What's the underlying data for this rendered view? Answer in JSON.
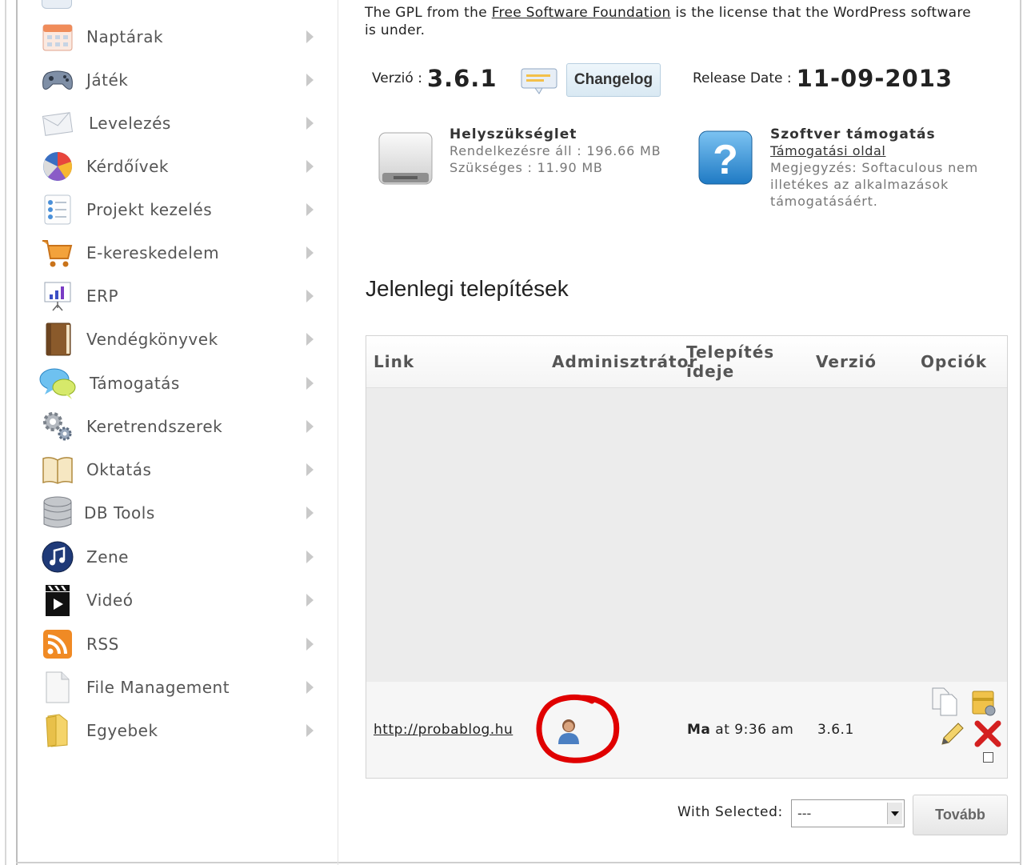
{
  "sidebar": {
    "items": [
      {
        "label": "Naptárak",
        "icon": "calendar-icon"
      },
      {
        "label": "Játék",
        "icon": "gamepad-icon"
      },
      {
        "label": "Levelezés",
        "icon": "envelope-icon"
      },
      {
        "label": "Kérdőívek",
        "icon": "pie-chart-icon"
      },
      {
        "label": "Projekt kezelés",
        "icon": "checklist-icon"
      },
      {
        "label": "E-kereskedelem",
        "icon": "cart-icon"
      },
      {
        "label": "ERP",
        "icon": "presentation-chart-icon"
      },
      {
        "label": "Vendégkönyvek",
        "icon": "book-icon"
      },
      {
        "label": "Támogatás",
        "icon": "chat-bubbles-icon"
      },
      {
        "label": "Keretrendszerek",
        "icon": "gears-icon"
      },
      {
        "label": "Oktatás",
        "icon": "open-book-icon"
      },
      {
        "label": "DB Tools",
        "icon": "database-icon"
      },
      {
        "label": "Zene",
        "icon": "music-note-icon"
      },
      {
        "label": "Videó",
        "icon": "clapperboard-icon"
      },
      {
        "label": "RSS",
        "icon": "rss-icon"
      },
      {
        "label": "File Management",
        "icon": "file-icon"
      },
      {
        "label": "Egyebek",
        "icon": "folder-icon"
      }
    ]
  },
  "license": {
    "prefix": "The GPL from the ",
    "link": "Free Software Foundation",
    "suffix": " is the license that the WordPress software is under."
  },
  "version": {
    "label": "Verzió :",
    "value": "3.6.1",
    "changelog_button": "Changelog",
    "release_label": "Release Date :",
    "release_date": "11-09-2013"
  },
  "space": {
    "title": "Helyszükséglet",
    "available": "Rendelkezésre áll : 196.66 MB",
    "required": "Szükséges : 11.90 MB"
  },
  "support": {
    "title": "Szoftver támogatás",
    "link": "Támogatási oldal",
    "note_line1": "Megjegyzés: Softaculous nem",
    "note_line2": "illetékes az alkalmazások",
    "note_line3": "támogatásáért."
  },
  "installations": {
    "title": "Jelenlegi telepítések",
    "columns": {
      "link": "Link",
      "admin": "Adminisztrátor",
      "install_time_line1": "Telepítés",
      "install_time_line2": "ideje",
      "version": "Verzió",
      "options": "Opciók"
    },
    "rows": [
      {
        "link": "http://probablog.hu",
        "time_bold": "Ma",
        "time_rest": " at 9:36 am",
        "version": "3.6.1"
      }
    ]
  },
  "bulk": {
    "label": "With Selected:",
    "selected_option": "---",
    "submit": "Tovább"
  },
  "colors": {
    "annotation_circle": "#e00000",
    "delete_x": "#d42020"
  }
}
